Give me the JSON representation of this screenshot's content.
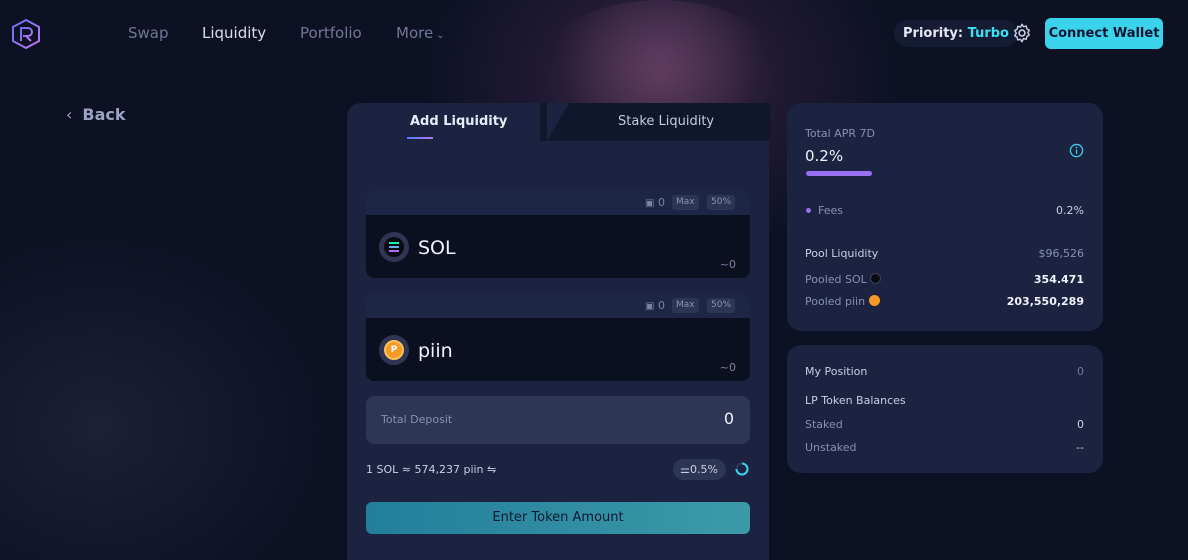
{
  "nav": {
    "links": [
      "Swap",
      "Liquidity",
      "Portfolio",
      "More"
    ],
    "priority_label": "Priority:",
    "priority_value": "Turbo",
    "connect_label": "Connect Wallet"
  },
  "back_label": "Back",
  "tabs": {
    "add": "Add Liquidity",
    "stake": "Stake Liquidity"
  },
  "token_a": {
    "symbol": "SOL",
    "balance": "0",
    "max": "Max",
    "half": "50%",
    "approx": "~0"
  },
  "token_b": {
    "symbol": "piin",
    "balance": "0",
    "max": "Max",
    "half": "50%",
    "approx": "~0"
  },
  "deposit": {
    "label": "Total Deposit",
    "value": "0"
  },
  "rate_text": "1 SOL ≈ 574,237 piin ⇋",
  "slippage": "0.5%",
  "enter_button": "Enter Token Amount",
  "pool": {
    "apr_label": "Total APR 7D",
    "apr_value": "0.2%",
    "apr_fill": 0.2,
    "fees_label": "Fees",
    "fees_value": "0.2%",
    "liquidity_label": "Pool Liquidity",
    "liquidity_value": "$96,526",
    "pooled_a_label": "Pooled SOL",
    "pooled_a_value": "354.471",
    "pooled_b_label": "Pooled piin",
    "pooled_b_value": "203,550,289"
  },
  "position": {
    "title": "My Position",
    "title_value": "0",
    "lp_label": "LP Token Balances",
    "staked_label": "Staked",
    "staked_value": "0",
    "unstaked_label": "Unstaked",
    "unstaked_value": "--"
  },
  "colors": {
    "accent": "#3bd3ec",
    "purple": "#9b6ff2",
    "bg": "#0c1124",
    "panel": "#1b2340"
  }
}
